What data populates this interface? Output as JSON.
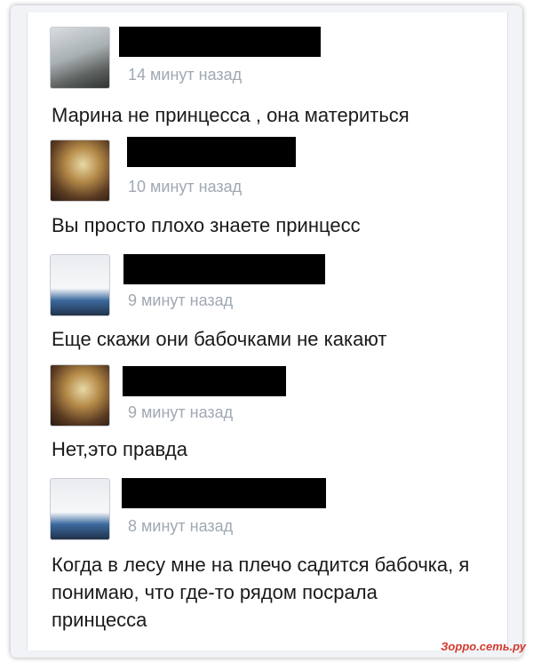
{
  "posts": [
    {
      "time": "14 минут назад",
      "text": "Марина не принцесса , она материться"
    },
    {
      "time": "10 минут назад",
      "text": "Вы просто плохо знаете принцесс"
    },
    {
      "time": "9 минут назад",
      "text": "Еще скажи они бабочками не какают"
    },
    {
      "time": "9 минут назад",
      "text": "Нет,это правда"
    },
    {
      "time": "8 минут назад",
      "text": "Когда в лесу мне на плечо садится бабочка, я понимаю, что где-то рядом посрала принцесса"
    }
  ],
  "watermark": "Зорро.сеть.ру",
  "colors": {
    "redaction": "#000000",
    "timestamp": "#a0a8b2",
    "text": "#1a1a1a"
  }
}
